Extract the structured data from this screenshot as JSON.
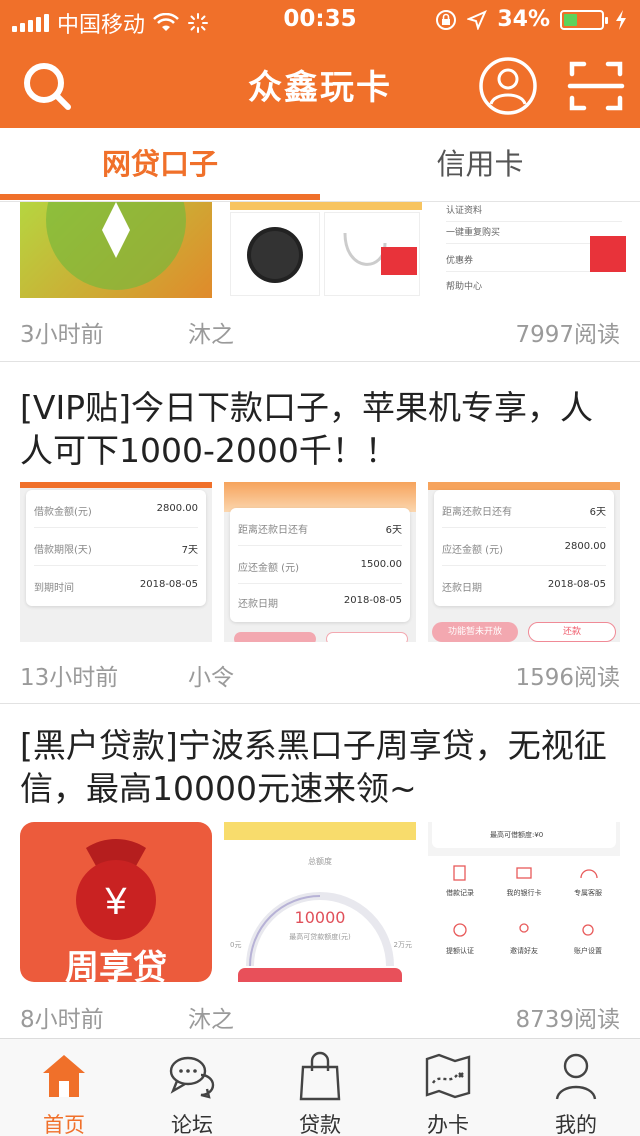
{
  "status_bar": {
    "carrier": "中国移动",
    "time": "00:35",
    "battery": "34%"
  },
  "header": {
    "title": "众鑫玩卡"
  },
  "tabs": [
    {
      "label": "网贷口子",
      "active": true
    },
    {
      "label": "信用卡",
      "active": false
    }
  ],
  "posts": [
    {
      "title": "",
      "time": "3小时前",
      "author": "沐之",
      "reads": "7997阅读",
      "thumb3_rows": [
        "认证资料",
        "一键重复购买",
        "优惠券",
        "帮助中心"
      ]
    },
    {
      "title": "[VIP贴]今日下款口子，苹果机专享，人人可下1000-2000千！！",
      "time": "13小时前",
      "author": "小令",
      "reads": "1596阅读",
      "thumb1_rows": [
        {
          "label": "借款金额(元)",
          "value": "2800.00"
        },
        {
          "label": "借款期限(天)",
          "value": "7天"
        },
        {
          "label": "到期时间",
          "value": "2018-08-05"
        }
      ],
      "thumb2_rows": [
        {
          "label": "距离还款日还有",
          "value": "6天"
        },
        {
          "label": "应还金额 (元)",
          "value": "1500.00"
        },
        {
          "label": "还款日期",
          "value": "2018-08-05"
        }
      ],
      "thumb3_rows": [
        {
          "label": "距离还款日还有",
          "value": "6天"
        },
        {
          "label": "应还金额 (元)",
          "value": "2800.00"
        },
        {
          "label": "还款日期",
          "value": "2018-08-05"
        }
      ],
      "thumb3_buttons": [
        "功能暂未开放",
        "还款"
      ]
    },
    {
      "title": "[黑户贷款]宁波系黑口子周享贷，无视征信，最高10000元速来领~",
      "time": "8小时前",
      "author": "沐之",
      "reads": "8739阅读",
      "app_icon_text": "周享贷",
      "gauge_label": "总额度",
      "gauge_value": "10000",
      "gauge_caption": "最高可贷款额度(元)",
      "gauge_min": "0元",
      "gauge_max": "2万元",
      "limit_text": "最高可借额度:¥0",
      "grid_items": [
        "借款记录",
        "我的银行卡",
        "专属客服",
        "提额认证",
        "邀请好友",
        "账户设置"
      ]
    }
  ],
  "bottom_nav": [
    {
      "label": "首页",
      "icon": "home-icon",
      "active": true
    },
    {
      "label": "论坛",
      "icon": "chat-icon",
      "active": false
    },
    {
      "label": "贷款",
      "icon": "bag-icon",
      "active": false
    },
    {
      "label": "办卡",
      "icon": "map-icon",
      "active": false
    },
    {
      "label": "我的",
      "icon": "user-icon",
      "active": false
    }
  ],
  "colors": {
    "accent": "#f0702a",
    "text": "#222222",
    "muted": "#9a9a9a"
  }
}
